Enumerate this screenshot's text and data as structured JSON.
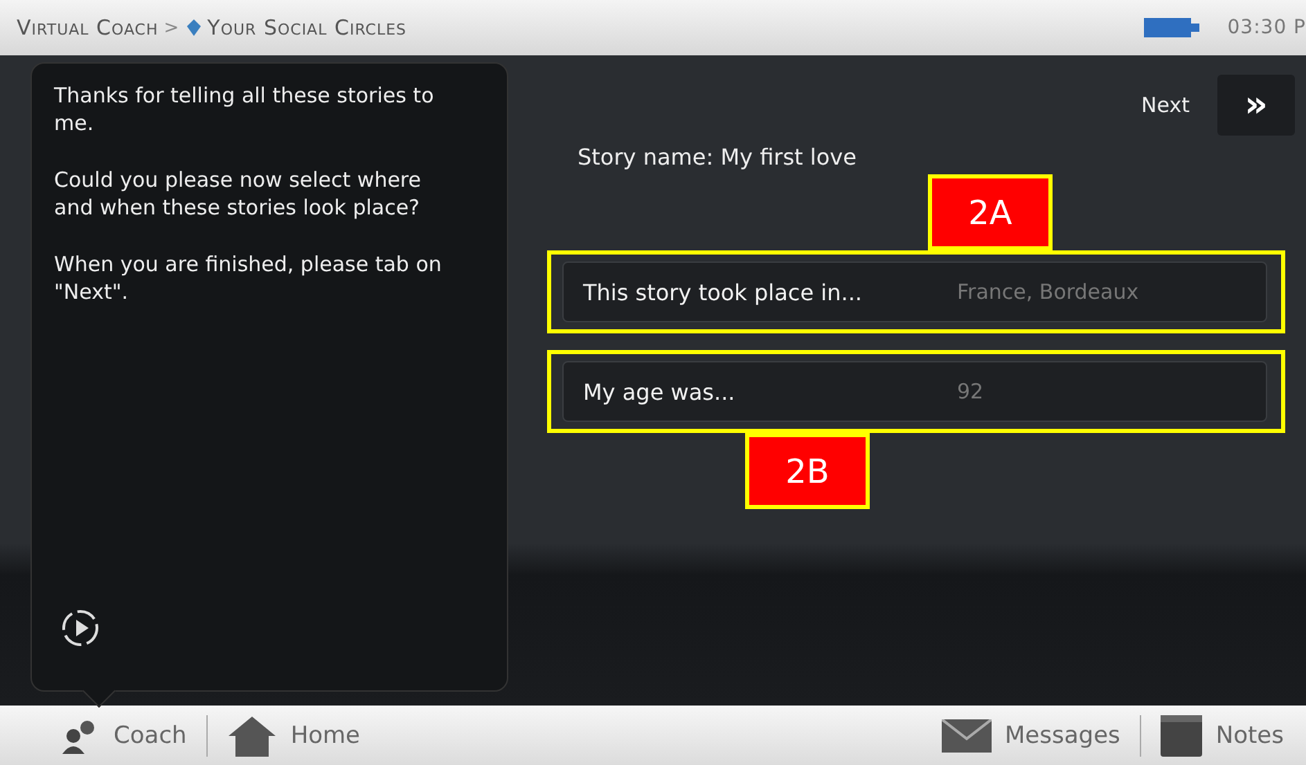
{
  "breadcrumb": {
    "items": [
      "Virtual Coach",
      "Your Social Circles"
    ],
    "separator": ">"
  },
  "status": {
    "time": "03:30 P"
  },
  "coach_message": {
    "paragraphs": [
      "Thanks for telling all these stories to me.",
      "Could you please now select where and when these stories look place?",
      "When you are finished, please tab on \"Next\"."
    ]
  },
  "next_button": {
    "label": "Next",
    "icon": "»"
  },
  "story_name": "Story name: My first love",
  "fields": [
    {
      "label": "This story took place in...",
      "value": "France, Bordeaux",
      "annotation": "2A",
      "kind": "above"
    },
    {
      "label": "My age was...",
      "value": "92",
      "annotation": "2B",
      "kind": "below"
    }
  ],
  "bottom_bar": {
    "items": [
      {
        "kind": "coach",
        "label": "Coach"
      },
      {
        "kind": "home",
        "label": "Home"
      },
      {
        "kind": "messages",
        "label": "Messages"
      },
      {
        "kind": "notes",
        "label": "Notes"
      }
    ]
  }
}
